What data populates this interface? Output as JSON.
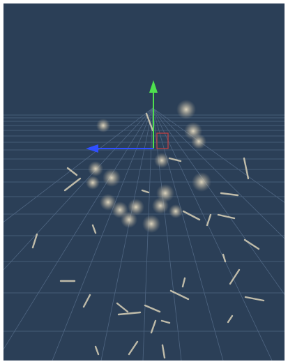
{
  "viewport": {
    "background": "#2b3f57",
    "grid_color": "#5b7391",
    "particle_color": "#d8cfb8",
    "streak_color": "#d9d1b8"
  },
  "gizmo": {
    "axes": [
      {
        "axis": "y",
        "color": "#4ee04e",
        "icon": "arrow-up-icon"
      },
      {
        "axis": "x",
        "color": "#2f4fff",
        "icon": "arrow-left-icon"
      }
    ],
    "center_handle_color": "#d04040"
  }
}
